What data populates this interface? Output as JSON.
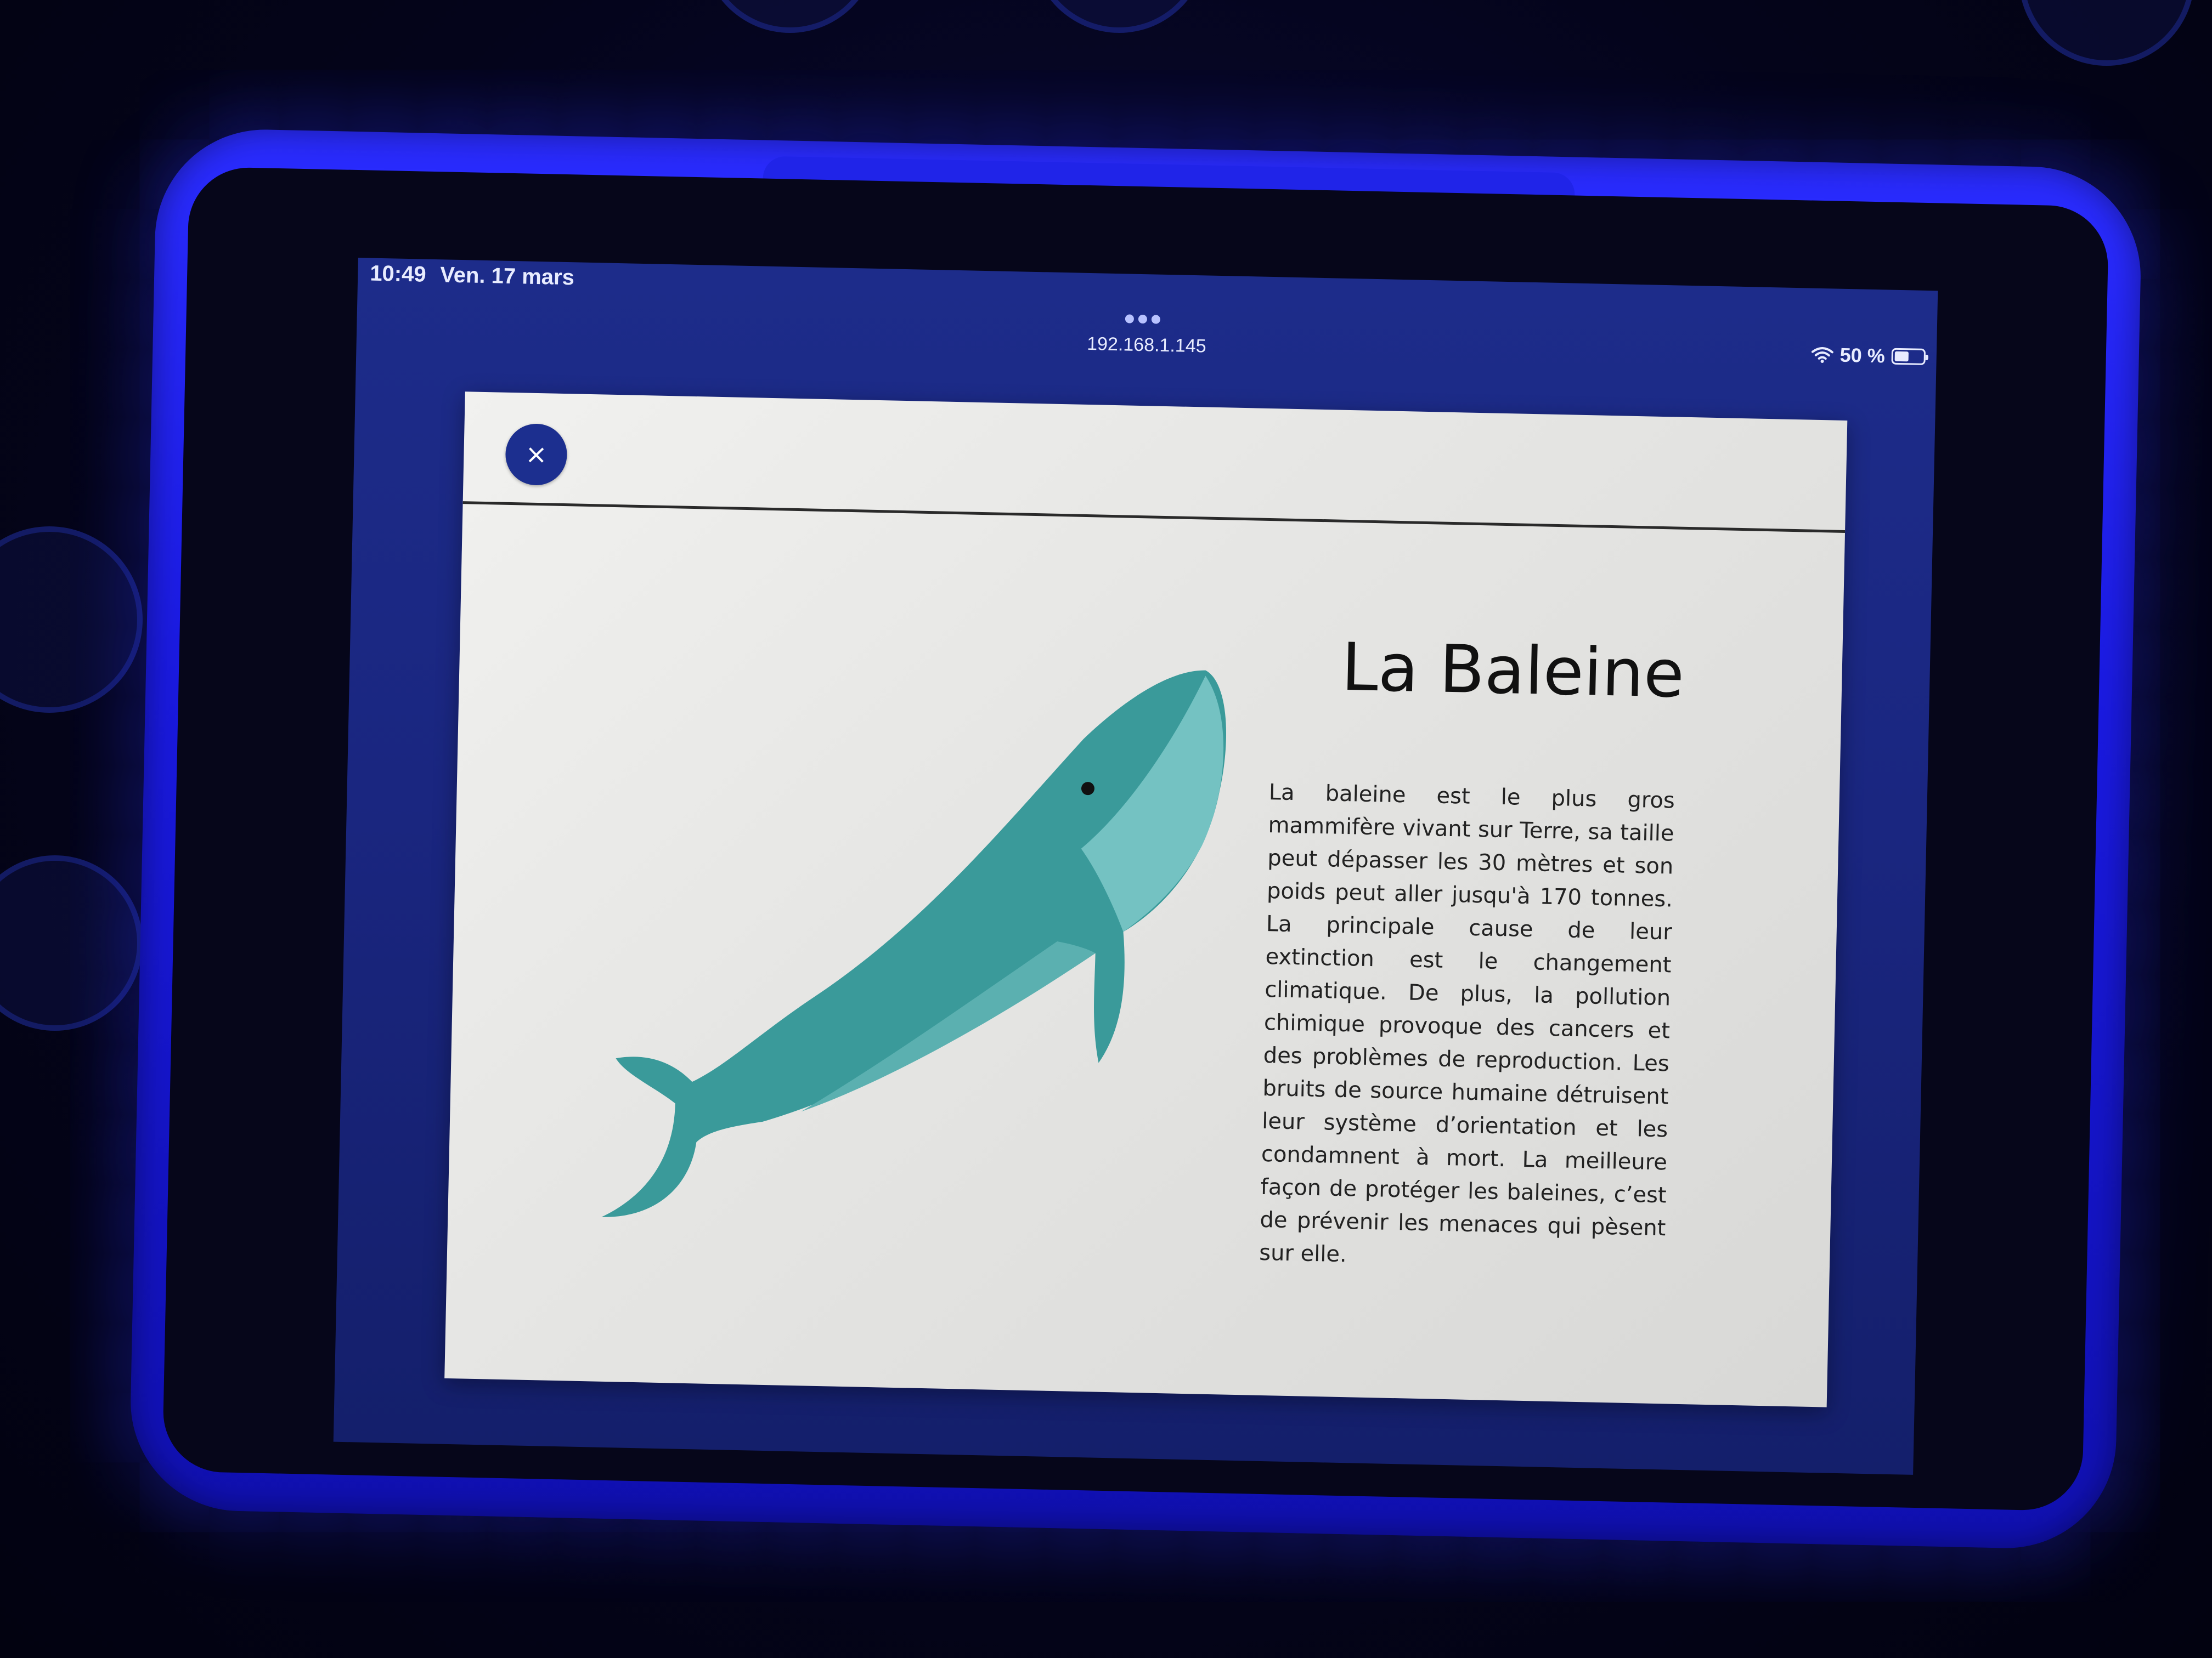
{
  "status_bar": {
    "time": "10:49",
    "date": "Ven. 17 mars",
    "url": "192.168.1.145",
    "battery": "50 %"
  },
  "modal": {
    "close_label": "×",
    "title": "La Baleine",
    "body": "La baleine est le plus gros mammifère vivant sur Terre, sa taille peut dépasser les 30 mètres et son poids peut aller jusqu'à 170 tonnes. La principale cause de leur extinction est le changement climatique. De plus, la pollution chimique provoque des cancers et des problèmes de reproduction. Les bruits de source humaine détruisent leur système d’orientation et les condamnent à mort. La meilleure façon de protéger les baleines, c’est de prévenir les menaces qui pèsent sur elle."
  },
  "colors": {
    "close_button": "#1c2f8f",
    "whale_body": "#3a9a9a",
    "whale_belly": "#6fbdbd",
    "screen_bg": "#1a2680"
  },
  "icons": {
    "whale": "whale-illustration",
    "wifi": "wifi-icon",
    "battery": "battery-icon",
    "close": "close-icon",
    "multitask": "multitask-dots-icon"
  }
}
